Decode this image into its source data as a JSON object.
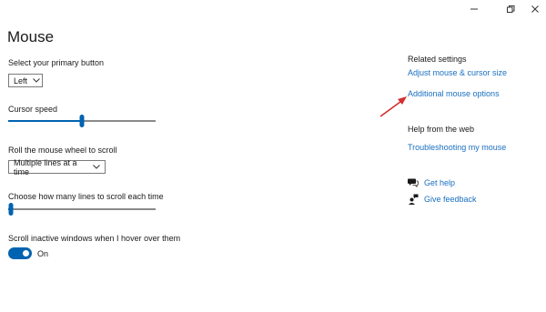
{
  "window": {
    "controls": {
      "minimize_icon": "minimize-icon",
      "maximize_icon": "restore-icon",
      "close_icon": "close-icon"
    }
  },
  "page": {
    "title": "Mouse"
  },
  "primary_button": {
    "label": "Select your primary button",
    "value": "Left"
  },
  "cursor_speed": {
    "label": "Cursor speed",
    "level": 0.5
  },
  "scroll_wheel": {
    "label": "Roll the mouse wheel to scroll",
    "value": "Multiple lines at a time"
  },
  "lines_to_scroll": {
    "label": "Choose how many lines to scroll each time",
    "level": 0.02
  },
  "inactive_scroll": {
    "label": "Scroll inactive windows when I hover over them",
    "state": "On"
  },
  "related_settings": {
    "heading": "Related settings",
    "links": [
      "Adjust mouse & cursor size",
      "Additional mouse options"
    ]
  },
  "help_from_web": {
    "heading": "Help from the web",
    "links": [
      "Troubleshooting my mouse"
    ]
  },
  "support": {
    "get_help": "Get help",
    "give_feedback": "Give feedback"
  },
  "colors": {
    "accent": "#0063b1",
    "link": "#1a6fc1",
    "annotation_arrow": "#d32f2f"
  }
}
